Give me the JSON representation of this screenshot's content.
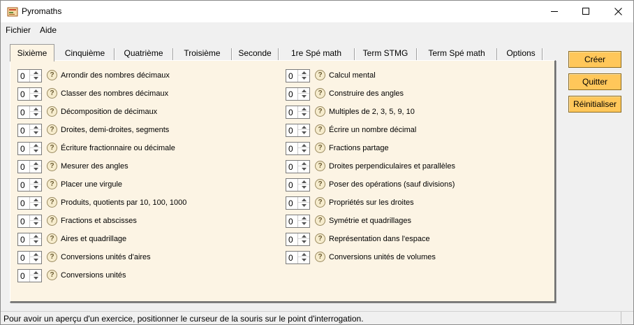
{
  "window": {
    "title": "Pyromaths"
  },
  "menu": [
    "Fichier",
    "Aide"
  ],
  "tabs": [
    "Sixième",
    "Cinquième",
    "Quatrième",
    "Troisième",
    "Seconde",
    "1re Spé math",
    "Term STMG",
    "Term Spé math",
    "Options"
  ],
  "active_tab": "Sixième",
  "exercises_left": [
    {
      "value": "0",
      "label": "Arrondir des nombres décimaux"
    },
    {
      "value": "0",
      "label": "Classer des nombres décimaux"
    },
    {
      "value": "0",
      "label": "Décomposition de décimaux"
    },
    {
      "value": "0",
      "label": "Droites, demi-droites, segments"
    },
    {
      "value": "0",
      "label": "Écriture fractionnaire ou décimale"
    },
    {
      "value": "0",
      "label": "Mesurer des angles"
    },
    {
      "value": "0",
      "label": "Placer une virgule"
    },
    {
      "value": "0",
      "label": "Produits, quotients par 10, 100, 1000"
    },
    {
      "value": "0",
      "label": "Fractions et abscisses"
    },
    {
      "value": "0",
      "label": "Aires et quadrillage"
    },
    {
      "value": "0",
      "label": "Conversions unités d'aires"
    },
    {
      "value": "0",
      "label": "Conversions unités"
    }
  ],
  "exercises_right": [
    {
      "value": "0",
      "label": "Calcul mental"
    },
    {
      "value": "0",
      "label": "Construire des angles"
    },
    {
      "value": "0",
      "label": "Multiples de 2, 3, 5, 9, 10"
    },
    {
      "value": "0",
      "label": "Écrire un nombre décimal"
    },
    {
      "value": "0",
      "label": "Fractions partage"
    },
    {
      "value": "0",
      "label": "Droites perpendiculaires et parallèles"
    },
    {
      "value": "0",
      "label": "Poser des opérations (sauf divisions)"
    },
    {
      "value": "0",
      "label": "Propriétés sur les droites"
    },
    {
      "value": "0",
      "label": "Symétrie et quadrillages"
    },
    {
      "value": "0",
      "label": "Représentation dans l'espace"
    },
    {
      "value": "0",
      "label": "Conversions unités de volumes"
    }
  ],
  "actions": {
    "create": "Créer",
    "quit": "Quitter",
    "reset": "Réinitialiser"
  },
  "help_glyph": "?",
  "status": "Pour avoir un aperçu d'un exercice, positionner le curseur de la souris sur le point d'interrogation.",
  "colors": {
    "panel": "#fcf4e4",
    "button": "#ffc75a"
  }
}
